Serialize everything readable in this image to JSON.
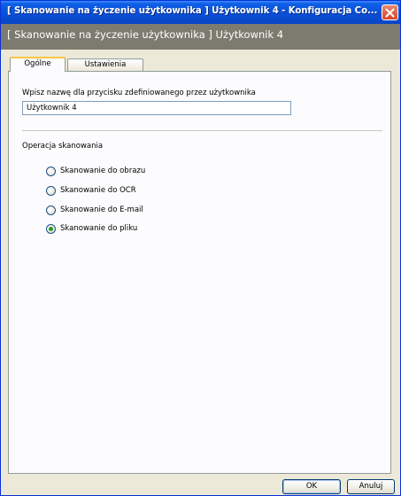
{
  "window": {
    "title": "[ Skanowanie na życzenie użytkownika ]  Użytkownik 4 - Konfiguracja Co...",
    "close_icon": "close-icon"
  },
  "header": {
    "text": "[ Skanowanie na życzenie użytkownika ]  Użytkownik 4"
  },
  "tabs": [
    {
      "label": "Ogólne",
      "active": true
    },
    {
      "label": "Ustawienia",
      "active": false
    }
  ],
  "general": {
    "name_label": "Wpisz nazwę dla przycisku zdefiniowanego przez użytkownika",
    "name_value": "Użytkownik 4",
    "scan_op_label": "Operacja skanowania",
    "options": [
      {
        "label": "Skanowanie do obrazu",
        "selected": false
      },
      {
        "label": "Skanowanie do OCR",
        "selected": false
      },
      {
        "label": "Skanowanie do E-mail",
        "selected": false
      },
      {
        "label": "Skanowanie do pliku",
        "selected": true
      }
    ]
  },
  "buttons": {
    "ok": "OK",
    "cancel": "Anuluj"
  },
  "colors": {
    "titlebar": "#0a4fd8",
    "header_band": "#7d7b6f",
    "dialog_bg": "#ece9d8",
    "radio_selected": "#21a121"
  }
}
